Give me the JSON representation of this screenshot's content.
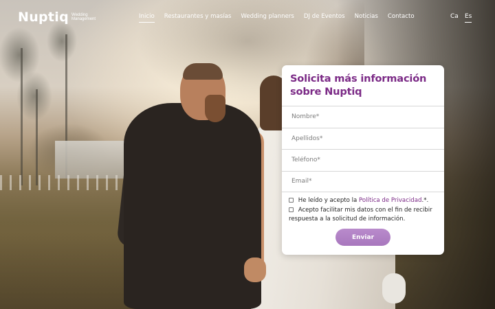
{
  "brand": {
    "name": "Nuptiq",
    "tagline_line1": "Wedding",
    "tagline_line2": "Management"
  },
  "nav": {
    "items": [
      {
        "label": "Inicio",
        "active": true
      },
      {
        "label": "Restaurantes y masías",
        "active": false
      },
      {
        "label": "Wedding planners",
        "active": false
      },
      {
        "label": "DJ de Eventos",
        "active": false
      },
      {
        "label": "Noticias",
        "active": false
      },
      {
        "label": "Contacto",
        "active": false
      }
    ]
  },
  "languages": {
    "ca": "Ca",
    "es": "Es",
    "selected": "Es"
  },
  "form": {
    "title": "Solicita más información sobre Nuptiq",
    "fields": {
      "nombre_placeholder": "Nombre*",
      "apellidos_placeholder": "Apellidos*",
      "telefono_placeholder": "Teléfono*",
      "email_placeholder": "Email*"
    },
    "consent_privacy_prefix": "He leído y acepto la",
    "consent_privacy_link": "Política de Privacidad",
    "consent_privacy_suffix": ".*.",
    "consent_data": "Acepto facilitar mis datos con el fin de recibir respuesta a la solicitud de información.",
    "submit_label": "Enviar"
  },
  "colors": {
    "brand_purple": "#7b2a86",
    "button_purple": "#b07fc4",
    "text_white": "#ffffff"
  }
}
